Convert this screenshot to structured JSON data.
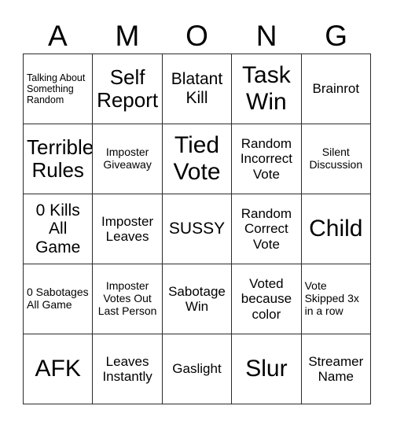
{
  "card": {
    "title_letters": [
      "A",
      "M",
      "O",
      "N",
      "G"
    ],
    "columns": 5,
    "rows": 5,
    "colors": {
      "background": "#ffffff",
      "grid_line": "#2b2b2b",
      "text": "#000000"
    },
    "cells": [
      {
        "row": 1,
        "col": 1,
        "text": "Talking About Something Random",
        "align": "left",
        "size": "xs"
      },
      {
        "row": 1,
        "col": 2,
        "text": "Self Report",
        "align": "center",
        "size": "xl"
      },
      {
        "row": 1,
        "col": 3,
        "text": "Blatant Kill",
        "align": "center",
        "size": "lg"
      },
      {
        "row": 1,
        "col": 4,
        "text": "Task Win",
        "align": "center",
        "size": "xxl"
      },
      {
        "row": 1,
        "col": 5,
        "text": "Brainrot",
        "align": "center",
        "size": "md"
      },
      {
        "row": 2,
        "col": 1,
        "text": "Terrible Rules",
        "align": "center",
        "size": "xl"
      },
      {
        "row": 2,
        "col": 2,
        "text": "Imposter Giveaway",
        "align": "center",
        "size": "sm"
      },
      {
        "row": 2,
        "col": 3,
        "text": "Tied Vote",
        "align": "center",
        "size": "xxl"
      },
      {
        "row": 2,
        "col": 4,
        "text": "Random Incorrect Vote",
        "align": "center",
        "size": "md"
      },
      {
        "row": 2,
        "col": 5,
        "text": "Silent Discussion",
        "align": "center",
        "size": "sm"
      },
      {
        "row": 3,
        "col": 1,
        "text": "0 Kills All Game",
        "align": "center",
        "size": "lg"
      },
      {
        "row": 3,
        "col": 2,
        "text": "Imposter Leaves",
        "align": "center",
        "size": "md"
      },
      {
        "row": 3,
        "col": 3,
        "text": "SUSSY",
        "align": "center",
        "size": "lg"
      },
      {
        "row": 3,
        "col": 4,
        "text": "Random Correct Vote",
        "align": "center",
        "size": "md"
      },
      {
        "row": 3,
        "col": 5,
        "text": "Child",
        "align": "center",
        "size": "xxl"
      },
      {
        "row": 4,
        "col": 1,
        "text": "0 Sabotages All Game",
        "align": "left",
        "size": "sm"
      },
      {
        "row": 4,
        "col": 2,
        "text": "Imposter Votes Out Last Person",
        "align": "center",
        "size": "sm"
      },
      {
        "row": 4,
        "col": 3,
        "text": "Sabotage Win",
        "align": "center",
        "size": "md"
      },
      {
        "row": 4,
        "col": 4,
        "text": "Voted because color",
        "align": "center",
        "size": "md"
      },
      {
        "row": 4,
        "col": 5,
        "text": "Vote Skipped 3x in a row",
        "align": "left",
        "size": "sm"
      },
      {
        "row": 5,
        "col": 1,
        "text": "AFK",
        "align": "center",
        "size": "xxl"
      },
      {
        "row": 5,
        "col": 2,
        "text": "Leaves Instantly",
        "align": "center",
        "size": "md"
      },
      {
        "row": 5,
        "col": 3,
        "text": "Gaslight",
        "align": "center",
        "size": "md"
      },
      {
        "row": 5,
        "col": 4,
        "text": "Slur",
        "align": "center",
        "size": "xxl"
      },
      {
        "row": 5,
        "col": 5,
        "text": "Streamer Name",
        "align": "center",
        "size": "md"
      }
    ]
  }
}
